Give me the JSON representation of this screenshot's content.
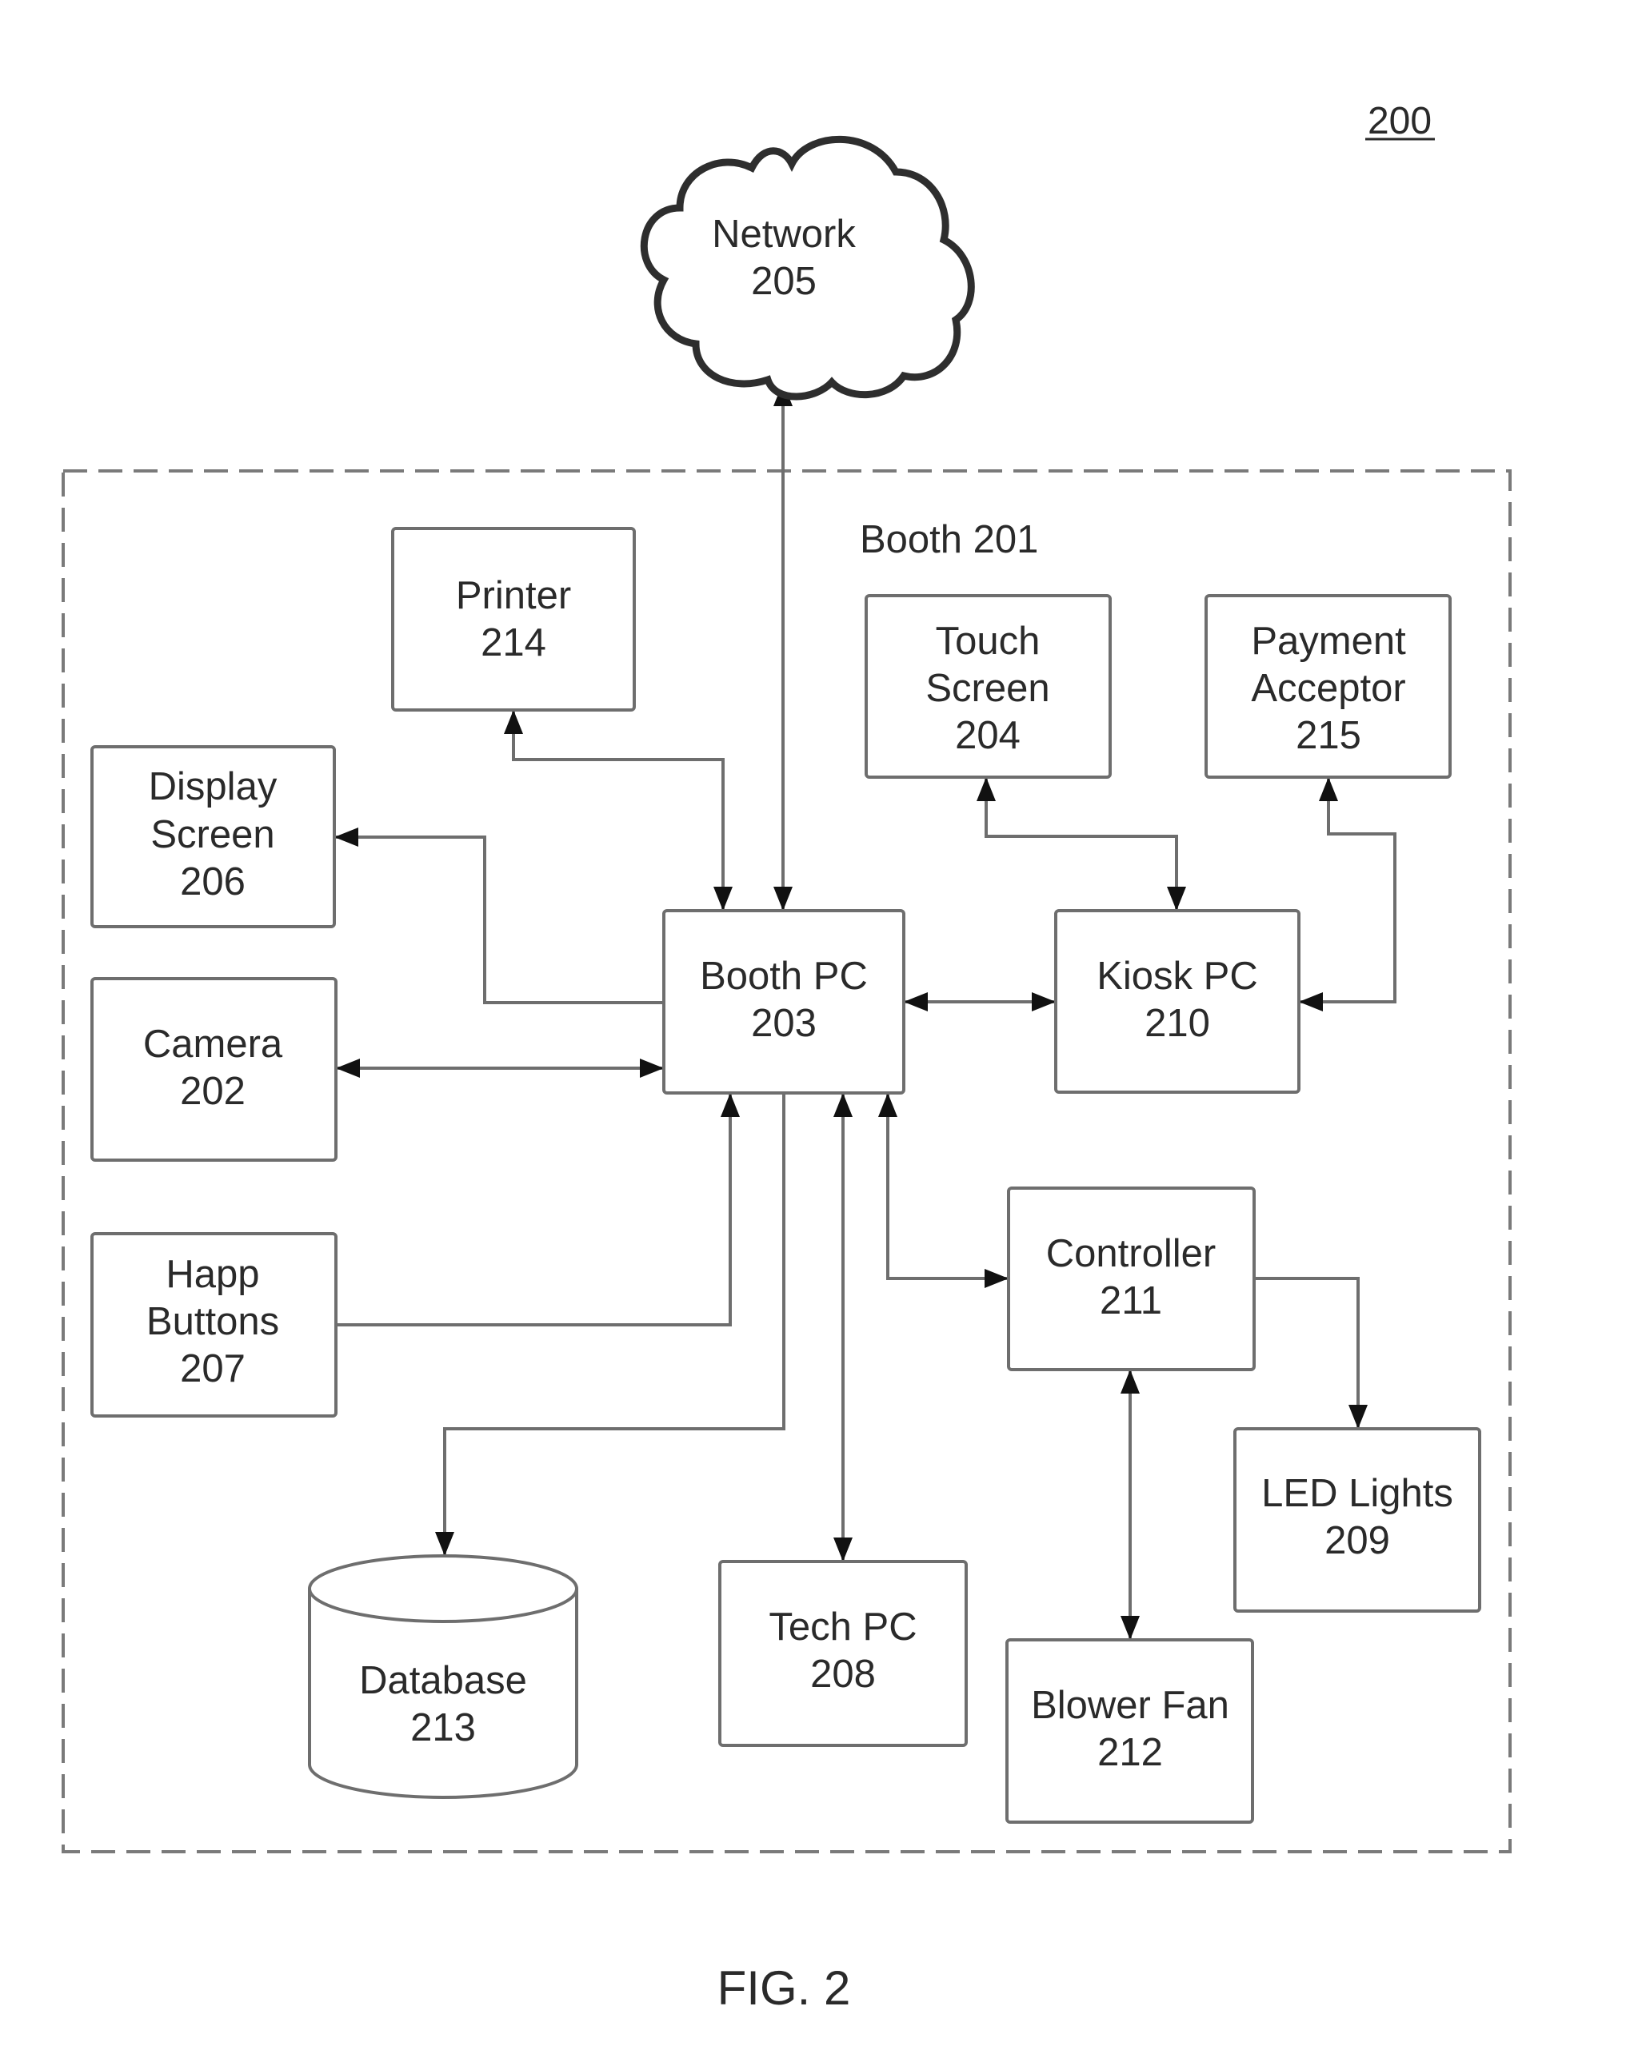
{
  "figure": {
    "reference_number": "200",
    "caption": "FIG. 2"
  },
  "boundary": {
    "label": "Booth 201"
  },
  "nodes": {
    "network": {
      "lines": [
        "Network",
        "205"
      ],
      "shape": "cloud"
    },
    "printer": {
      "lines": [
        "Printer",
        "214"
      ],
      "shape": "box"
    },
    "display": {
      "lines": [
        "Display",
        "Screen",
        "206"
      ],
      "shape": "box"
    },
    "camera": {
      "lines": [
        "Camera",
        "202"
      ],
      "shape": "box"
    },
    "happ": {
      "lines": [
        "Happ",
        "Buttons",
        "207"
      ],
      "shape": "box"
    },
    "booth_pc": {
      "lines": [
        "Booth PC",
        "203"
      ],
      "shape": "box"
    },
    "touch": {
      "lines": [
        "Touch",
        "Screen",
        "204"
      ],
      "shape": "box"
    },
    "payment": {
      "lines": [
        "Payment",
        "Acceptor",
        "215"
      ],
      "shape": "box"
    },
    "kiosk_pc": {
      "lines": [
        "Kiosk PC",
        "210"
      ],
      "shape": "box"
    },
    "controller": {
      "lines": [
        "Controller",
        "211"
      ],
      "shape": "box"
    },
    "led": {
      "lines": [
        "LED Lights",
        "209"
      ],
      "shape": "box"
    },
    "tech_pc": {
      "lines": [
        "Tech PC",
        "208"
      ],
      "shape": "box"
    },
    "blower": {
      "lines": [
        "Blower Fan",
        "212"
      ],
      "shape": "box"
    },
    "database": {
      "lines": [
        "Database",
        "213"
      ],
      "shape": "cylinder"
    }
  },
  "connections": [
    {
      "from": "network",
      "to": "booth_pc",
      "direction": "both"
    },
    {
      "from": "printer",
      "to": "booth_pc",
      "direction": "both"
    },
    {
      "from": "booth_pc",
      "to": "display",
      "direction": "forward"
    },
    {
      "from": "camera",
      "to": "booth_pc",
      "direction": "both"
    },
    {
      "from": "happ",
      "to": "booth_pc",
      "direction": "forward"
    },
    {
      "from": "booth_pc",
      "to": "database",
      "direction": "forward"
    },
    {
      "from": "booth_pc",
      "to": "tech_pc",
      "direction": "both"
    },
    {
      "from": "booth_pc",
      "to": "controller",
      "direction": "both"
    },
    {
      "from": "booth_pc",
      "to": "kiosk_pc",
      "direction": "both"
    },
    {
      "from": "touch",
      "to": "kiosk_pc",
      "direction": "both"
    },
    {
      "from": "payment",
      "to": "kiosk_pc",
      "direction": "both"
    },
    {
      "from": "controller",
      "to": "led",
      "direction": "forward"
    },
    {
      "from": "controller",
      "to": "blower",
      "direction": "both"
    }
  ]
}
